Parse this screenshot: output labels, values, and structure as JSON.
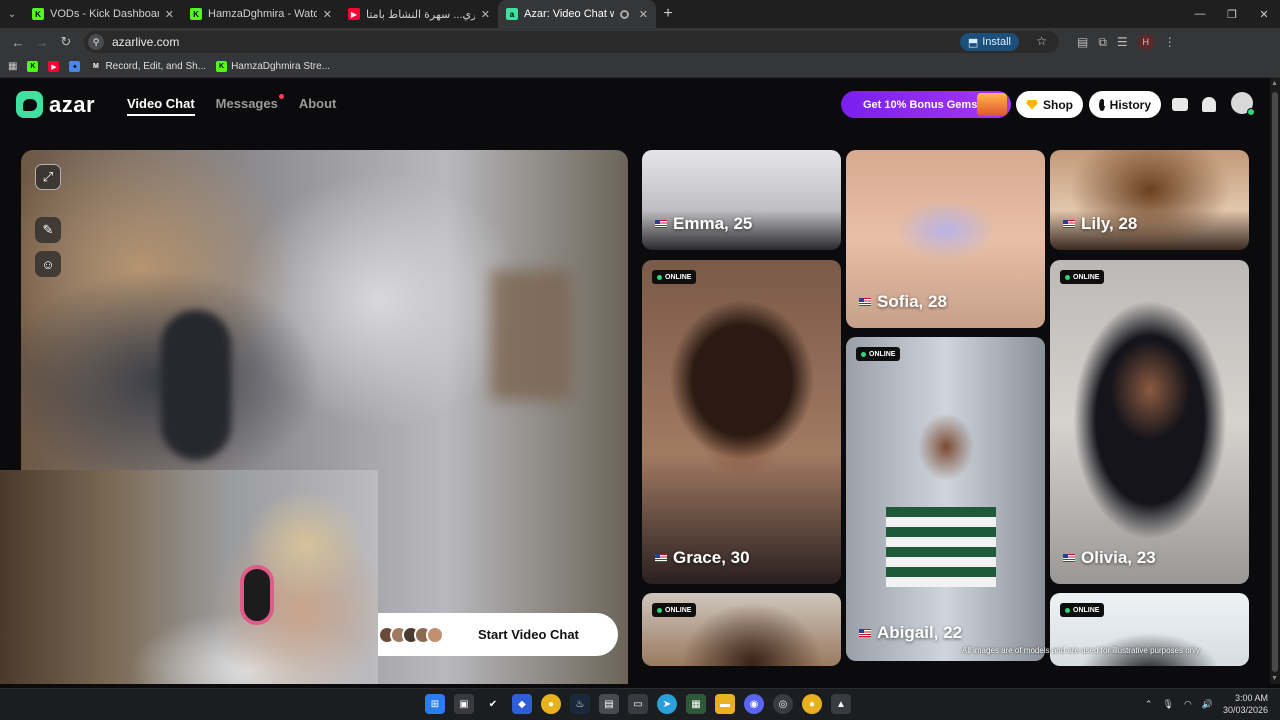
{
  "browser": {
    "tabs": [
      {
        "title": "VODs - Kick Dashboard",
        "icon": "kick-icon",
        "color": "#53fc18",
        "active": false
      },
      {
        "title": "HamzaDghmira - Watch the VO",
        "icon": "kick-icon",
        "color": "#53fc18",
        "active": false
      },
      {
        "title": "والجداري... سهرة النشاط بامتا",
        "icon": "youtube-icon",
        "color": "#ff0033",
        "active": false
      },
      {
        "title": "Azar: Video Chat with New",
        "icon": "azar-icon",
        "color": "#3fe0a0",
        "active": true
      }
    ],
    "url": "azarlive.com",
    "install_label": "Install",
    "bookmarks": [
      {
        "label": "",
        "icon": "kick-icon"
      },
      {
        "label": "",
        "icon": "youtube-icon"
      },
      {
        "label": "",
        "icon": "extension-icon"
      },
      {
        "label": "Record, Edit, and Sh...",
        "icon": "loom-icon"
      },
      {
        "label": "HamzaDghmira Stre...",
        "icon": "kick-icon"
      }
    ],
    "profile_initial": "H"
  },
  "site": {
    "logo_text": "azar",
    "nav": {
      "video_chat": "Video Chat",
      "messages": "Messages",
      "about": "About"
    },
    "promo_label": "Get 10% Bonus Gems",
    "shop_label": "Shop",
    "history_label": "History",
    "start_label": "Start Video Chat",
    "disclaimer": "All images are of models and are used for illustrative purposes only",
    "accent": "#3fe0a0",
    "online_label": "ONLINE"
  },
  "profiles": [
    {
      "name": "Emma, 25",
      "online": false
    },
    {
      "name": "Sofia, 28",
      "online": false
    },
    {
      "name": "Lily, 28",
      "online": false
    },
    {
      "name": "Grace, 30",
      "online": true
    },
    {
      "name": "Abigail, 22",
      "online": true
    },
    {
      "name": "Olivia, 23",
      "online": true
    },
    {
      "name": "",
      "online": true
    },
    {
      "name": "",
      "online": true
    }
  ],
  "taskbar": {
    "time": "3:00 AM",
    "date": "30/03/2026"
  }
}
